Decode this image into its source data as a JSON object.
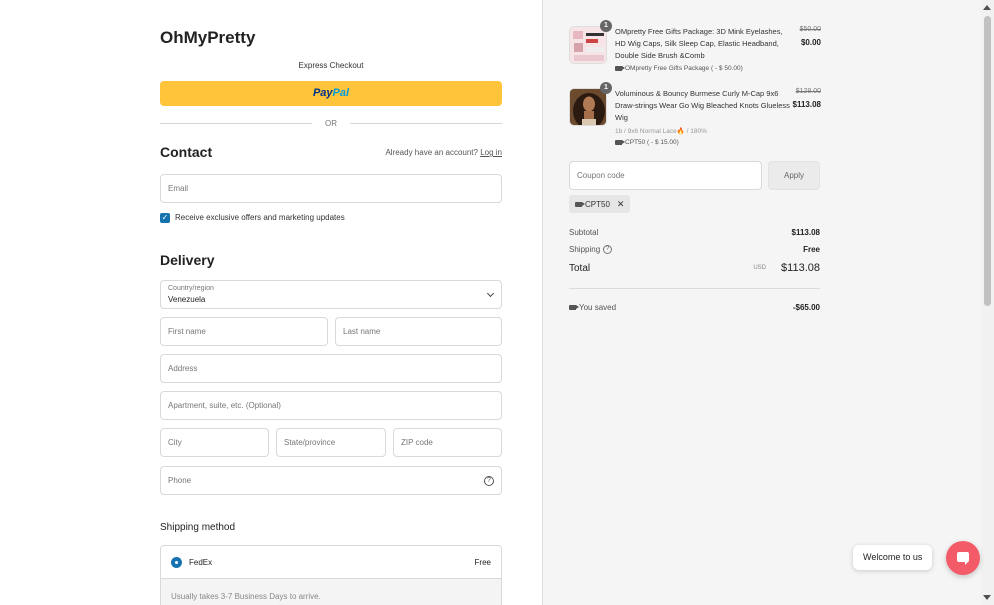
{
  "brand": "OhMyPretty",
  "express": {
    "title": "Express Checkout",
    "paypal_a": "Pay",
    "paypal_b": "Pal",
    "or": "OR"
  },
  "contact": {
    "title": "Contact",
    "login_prompt": "Already have an account?",
    "login_link": "Log in",
    "email_placeholder": "Email",
    "offers_label": "Receive exclusive offers and marketing updates",
    "offers_checked": true
  },
  "delivery": {
    "title": "Delivery",
    "country_label": "Country/region",
    "country_value": "Venezuela",
    "first_name": "First name",
    "last_name": "Last name",
    "address": "Address",
    "apartment": "Apartment, suite, etc. (Optional)",
    "city": "City",
    "state": "State/province",
    "zip": "ZIP code",
    "phone": "Phone"
  },
  "shipping": {
    "title": "Shipping method",
    "option_name": "FedEx",
    "option_price": "Free",
    "option_note": "Usually takes 3-7 Business Days to arrive."
  },
  "cart": {
    "items": [
      {
        "qty": "1",
        "title": "OMpretty Free Gifts Package: 3D Mink Eyelashes, HD Wig Caps, Silk Sleep Cap, Elastic Headband, Double Side Brush &Comb",
        "variant": "",
        "discount": "OMpretty Free Gifts Package ( - $ 50.00)",
        "old_price": "$50.00",
        "price": "$0.00"
      },
      {
        "qty": "1",
        "title": "Voluminous & Bouncy Burmese Curly M-Cap 9x6 Draw-strings Wear Go Wig Bleached Knots Glueless Wig",
        "variant": "1b / 9x6 Normal Lace🔥 / 180%",
        "discount": "CPT50 ( - $ 15.00)",
        "old_price": "$128.00",
        "price": "$113.08"
      }
    ],
    "coupon_placeholder": "Coupon code",
    "apply_label": "Apply",
    "applied_code": "CPT50",
    "subtotal_label": "Subtotal",
    "subtotal_value": "$113.08",
    "shipping_label": "Shipping",
    "shipping_value": "Free",
    "total_label": "Total",
    "currency": "USD",
    "total_value": "$113.08",
    "saved_label": "You saved",
    "saved_value": "-$65.00"
  },
  "chat": {
    "welcome": "Welcome to us"
  },
  "colors": {
    "paypal": "#ffc439",
    "accent": "#1773b0",
    "chat": "#f45b69"
  }
}
